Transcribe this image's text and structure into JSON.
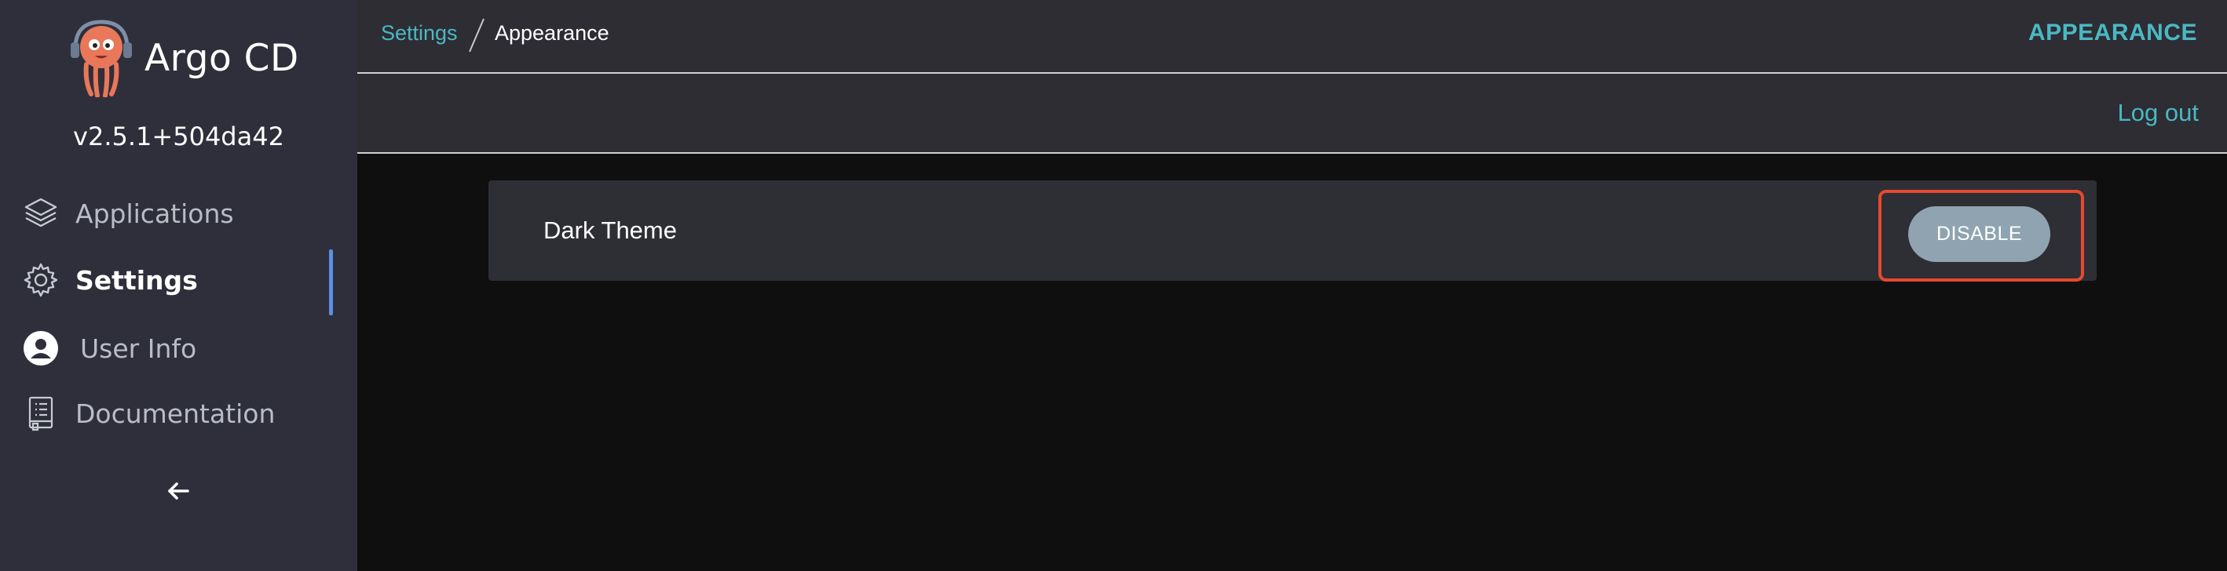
{
  "sidebar": {
    "brand": "Argo CD",
    "version": "v2.5.1+504da42",
    "items": [
      {
        "label": "Applications",
        "icon": "layers-icon"
      },
      {
        "label": "Settings",
        "icon": "gear-icon",
        "active": true
      },
      {
        "label": "User Info",
        "icon": "user-circle-icon"
      },
      {
        "label": "Documentation",
        "icon": "book-icon"
      }
    ],
    "collapse_icon": "arrow-left-icon"
  },
  "header": {
    "breadcrumb_parent": "Settings",
    "breadcrumb_current": "Appearance",
    "title": "APPEARANCE"
  },
  "toolbar": {
    "logout_label": "Log out"
  },
  "appearance": {
    "setting_label": "Dark Theme",
    "button_label": "DISABLE"
  },
  "colors": {
    "sidebar_bg": "#2f2f3b",
    "topbar_bg": "#2d2d33",
    "content_bg": "#0f0f10",
    "accent": "#4ab8c4",
    "active_indicator": "#5b8fe6",
    "button_bg": "#8fa4b0",
    "highlight": "#e64a2e"
  }
}
